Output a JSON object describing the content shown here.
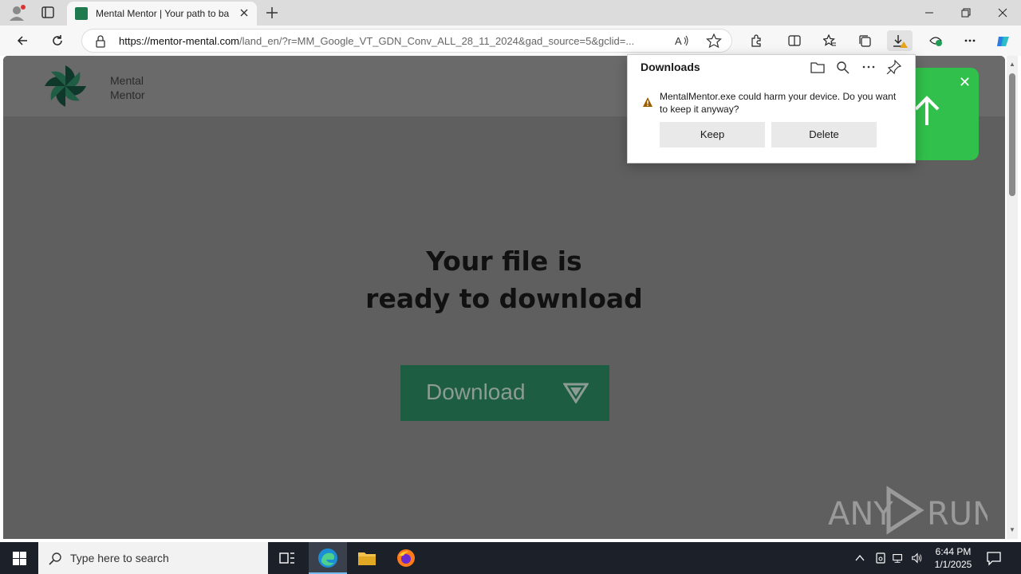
{
  "browser": {
    "tab_title": "Mental Mentor | Your path to bal",
    "url_domain": "https://mentor-mental.com",
    "url_path": "/land_en/?r=MM_Google_VT_GDN_Conv_ALL_28_11_2024&gad_source=5&gclid=..."
  },
  "site": {
    "logo_line1": "Mental",
    "logo_line2": "Mentor",
    "hero_line1": "Your file is",
    "hero_line2": "ready to download",
    "download_label": "Download",
    "brand_color": "#1d5e42"
  },
  "downloads_panel": {
    "title": "Downloads",
    "warning_message": "MentalMentor.exe could harm your device. Do you want to keep it anyway?",
    "keep_label": "Keep",
    "delete_label": "Delete"
  },
  "taskbar": {
    "search_placeholder": "Type here to search",
    "time": "6:44 PM",
    "date": "1/1/2025"
  },
  "watermark": {
    "text": "ANY RUN"
  }
}
